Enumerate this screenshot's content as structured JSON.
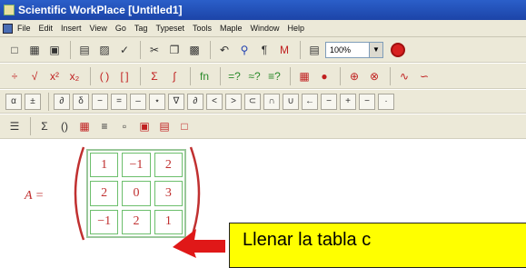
{
  "window": {
    "title": "Scientific WorkPlace  [Untitled1]"
  },
  "menu": [
    "File",
    "Edit",
    "Insert",
    "View",
    "Go",
    "Tag",
    "Typeset",
    "Tools",
    "Maple",
    "Window",
    "Help"
  ],
  "toolbar": {
    "zoom_value": "100%"
  },
  "document": {
    "matrix_label": "A =",
    "matrix": [
      [
        "1",
        "−1",
        "2"
      ],
      [
        "2",
        "0",
        "3"
      ],
      [
        "−1",
        "2",
        "1"
      ]
    ],
    "callout": "Llenar la tabla c"
  },
  "colors": {
    "math": "#c03030",
    "callout_bg": "#ffff00",
    "titlebar": "#2b5fc9"
  }
}
